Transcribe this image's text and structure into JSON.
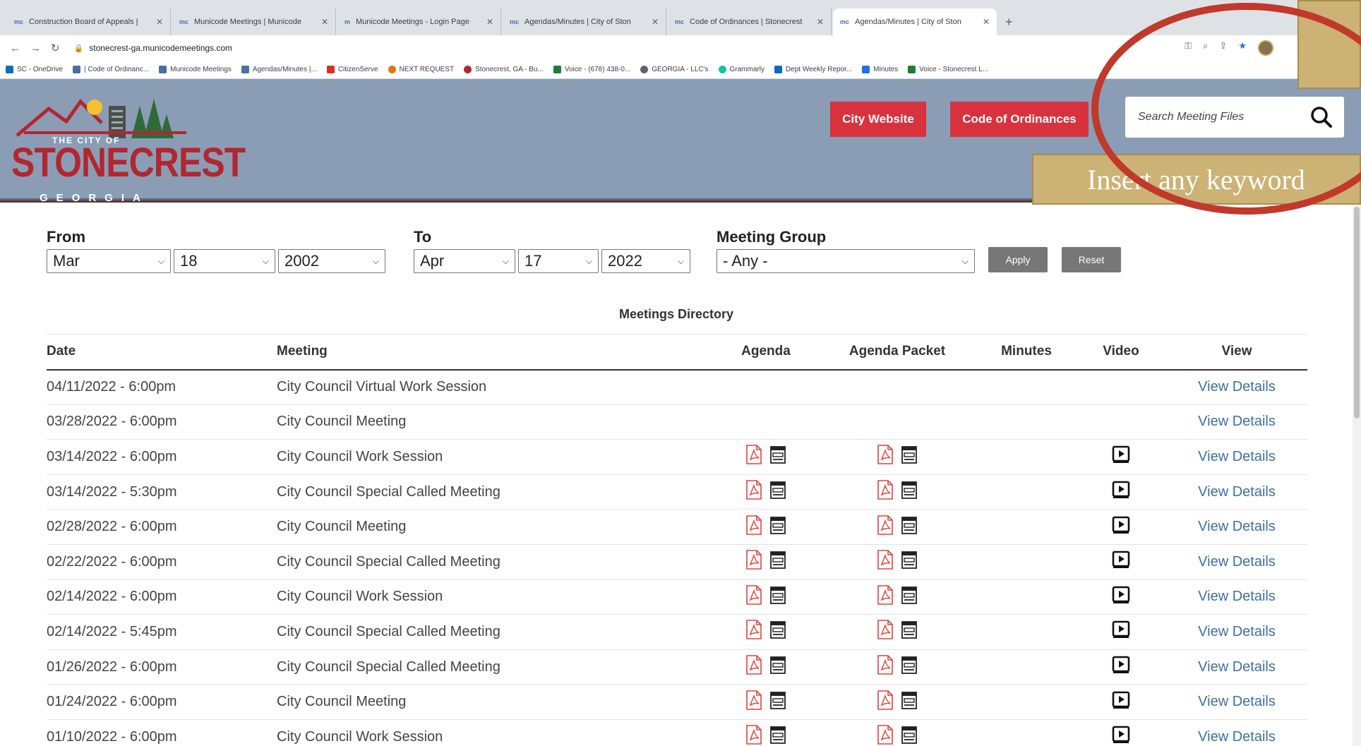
{
  "browser": {
    "tabs": [
      {
        "favicon": "mc",
        "label": "Construction Board of Appeals |"
      },
      {
        "favicon": "mc",
        "label": "Municode Meetings | Municode"
      },
      {
        "favicon": "m",
        "label": "Municode Meetings - Login Page"
      },
      {
        "favicon": "mc",
        "label": "Agendas/Minutes | City of Ston"
      },
      {
        "favicon": "mc",
        "label": "Code of Ordinances | Stonecrest"
      },
      {
        "favicon": "mc",
        "label": "Agendas/Minutes | City of Ston"
      }
    ],
    "url": "stonecrest-ga.municodemeetings.com",
    "bookmarks": [
      {
        "label": "SC - OneDrive",
        "color": "#0f6cbd"
      },
      {
        "label": "| Code of Ordinanc...",
        "color": "#4a6fa5"
      },
      {
        "label": "Municode Meetings",
        "color": "#4a6fa5"
      },
      {
        "label": "Agendas/Minutes |...",
        "color": "#4a6fa5"
      },
      {
        "label": "CitizenServe",
        "color": "#d93025"
      },
      {
        "label": "NEXT REQUEST",
        "color": "#e8710a"
      },
      {
        "label": "Stonecrest, GA - Bu...",
        "color": "#b3262e"
      },
      {
        "label": "Voice - (678) 438-0...",
        "color": "#188038"
      },
      {
        "label": "GEORGIA - LLC's",
        "color": "#5f6368"
      },
      {
        "label": "Grammarly",
        "color": "#15c39a"
      },
      {
        "label": "Dept Weekly Repor...",
        "color": "#0f6cbd"
      },
      {
        "label": "Minutes",
        "color": "#1a73e8"
      },
      {
        "label": "Voice - Stonecrest L...",
        "color": "#188038"
      }
    ]
  },
  "site": {
    "logo": {
      "city": "THE CITY OF",
      "name": "STONECREST",
      "state": "GEORGIA"
    },
    "city_website": "City Website",
    "code_of_ordinances": "Code of Ordinances",
    "search_placeholder": "Search Meeting Files"
  },
  "annotation": {
    "callout": "Insert any keyword"
  },
  "filters": {
    "from_label": "From",
    "from": {
      "month": "Mar",
      "day": "18",
      "year": "2002"
    },
    "to_label": "To",
    "to": {
      "month": "Apr",
      "day": "17",
      "year": "2022"
    },
    "group_label": "Meeting Group",
    "group": "- Any -",
    "apply": "Apply",
    "reset": "Reset"
  },
  "directory": {
    "title": "Meetings Directory",
    "headers": [
      "Date",
      "Meeting",
      "Agenda",
      "Agenda Packet",
      "Minutes",
      "Video",
      "View"
    ],
    "rows": [
      {
        "date": "04/11/2022 - 6:00pm",
        "meeting": "City Council Virtual Work Session",
        "agenda": false,
        "packet": false,
        "video": false,
        "view": "View Details"
      },
      {
        "date": "03/28/2022 - 6:00pm",
        "meeting": "City Council Meeting",
        "agenda": false,
        "packet": false,
        "video": false,
        "view": "View Details"
      },
      {
        "date": "03/14/2022 - 6:00pm",
        "meeting": "City Council Work Session",
        "agenda": true,
        "packet": true,
        "video": true,
        "view": "View Details"
      },
      {
        "date": "03/14/2022 - 5:30pm",
        "meeting": "City Council Special Called Meeting",
        "agenda": true,
        "packet": true,
        "video": true,
        "view": "View Details"
      },
      {
        "date": "02/28/2022 - 6:00pm",
        "meeting": "City Council Meeting",
        "agenda": true,
        "packet": true,
        "video": true,
        "view": "View Details"
      },
      {
        "date": "02/22/2022 - 6:00pm",
        "meeting": "City Council Special Called Meeting",
        "agenda": true,
        "packet": true,
        "video": true,
        "view": "View Details"
      },
      {
        "date": "02/14/2022 - 6:00pm",
        "meeting": "City Council Work Session",
        "agenda": true,
        "packet": true,
        "video": true,
        "view": "View Details"
      },
      {
        "date": "02/14/2022 - 5:45pm",
        "meeting": "City Council Special Called Meeting",
        "agenda": true,
        "packet": true,
        "video": true,
        "view": "View Details"
      },
      {
        "date": "01/26/2022 - 6:00pm",
        "meeting": "City Council Special Called Meeting",
        "agenda": true,
        "packet": true,
        "video": true,
        "view": "View Details"
      },
      {
        "date": "01/24/2022 - 6:00pm",
        "meeting": "City Council Meeting",
        "agenda": true,
        "packet": true,
        "video": true,
        "view": "View Details"
      },
      {
        "date": "01/10/2022 - 6:00pm",
        "meeting": "City Council Work Session",
        "agenda": true,
        "packet": true,
        "video": true,
        "view": "View Details"
      }
    ]
  }
}
